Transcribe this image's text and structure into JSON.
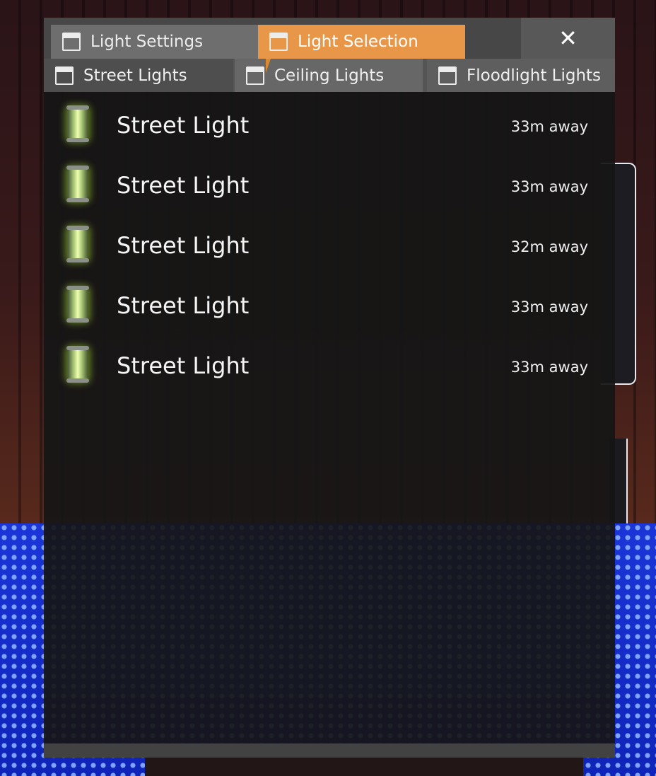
{
  "tabs": {
    "settings_label": "Light Settings",
    "selection_label": "Light Selection",
    "close_label": "✕"
  },
  "subtabs": {
    "street_label": "Street Lights",
    "ceiling_label": "Ceiling Lights",
    "flood_label": "Floodlight Lights"
  },
  "lights": [
    {
      "name": "Street Light",
      "distance": "33m away"
    },
    {
      "name": "Street Light",
      "distance": "33m away"
    },
    {
      "name": "Street Light",
      "distance": "32m away"
    },
    {
      "name": "Street Light",
      "distance": "33m away"
    },
    {
      "name": "Street Light",
      "distance": "33m away"
    }
  ],
  "colors": {
    "active_tab": "#e89748",
    "lamp_glow": "#c8ff3c"
  },
  "icons": {
    "tab_icon": "window-icon",
    "light_icon": "street-lamp-icon"
  }
}
